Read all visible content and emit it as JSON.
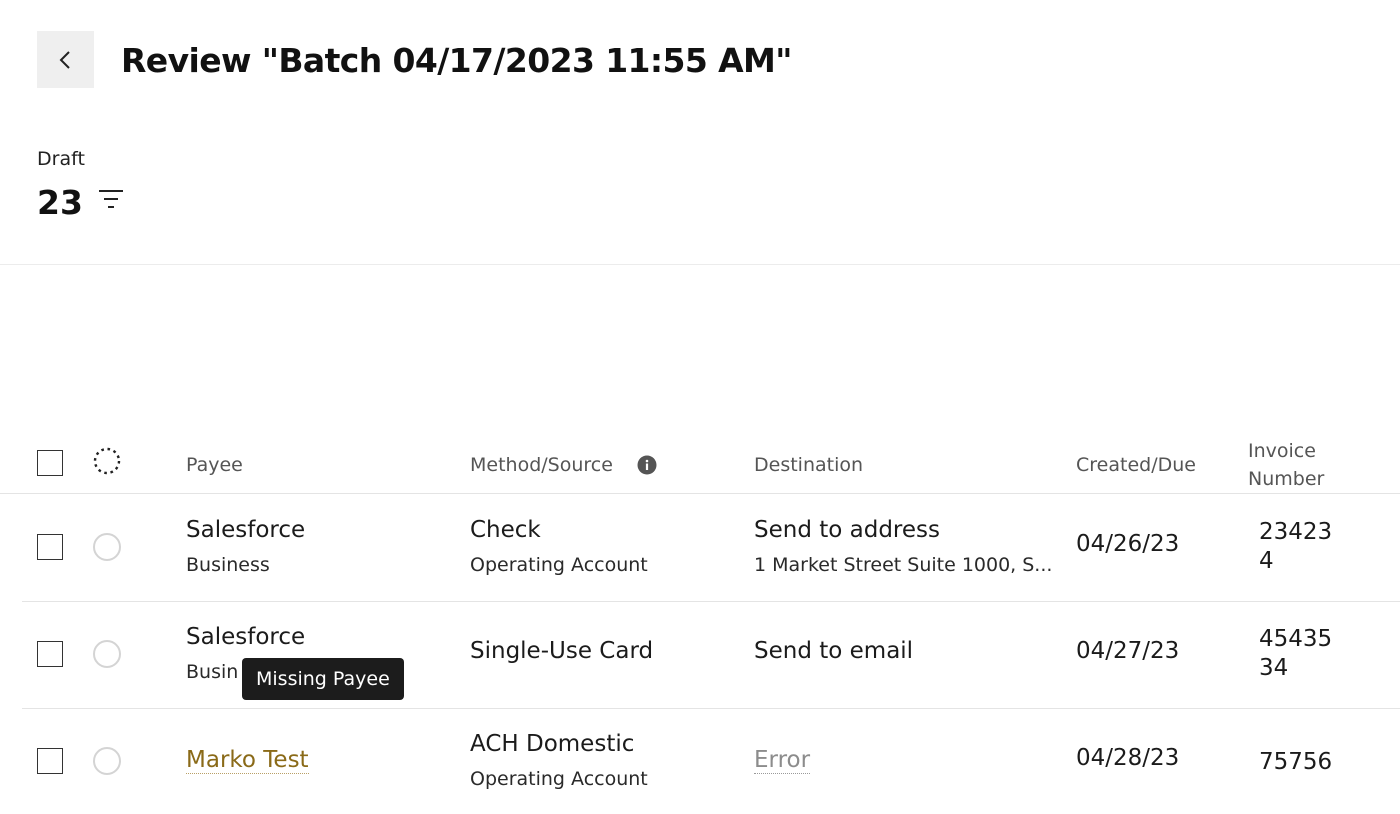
{
  "header": {
    "title": "Review \"Batch 04/17/2023 11:55 AM\"",
    "back_icon": "chevron-left-icon"
  },
  "summary": {
    "status_label": "Draft",
    "count": "23",
    "filter_icon": "filter-icon"
  },
  "table": {
    "columns": {
      "payee": "Payee",
      "method_source": "Method/Source",
      "destination": "Destination",
      "created_due": "Created/Due",
      "invoice_number": "Invoice Number"
    },
    "status_header_icon": "dashed-circle-icon",
    "info_icon": "info-icon",
    "rows": [
      {
        "payee": "Salesforce",
        "payee_type": "Business",
        "method": "Check",
        "source": "Operating Account",
        "destination": "Send to address",
        "destination_detail": "1 Market Street Suite 1000, S...",
        "created_due": "04/26/23",
        "invoice_number": "234234"
      },
      {
        "payee": "Salesforce",
        "payee_type": "Busin",
        "method": "Single-Use Card",
        "source": "",
        "destination": "Send to email",
        "destination_detail": "",
        "created_due": "04/27/23",
        "invoice_number": "4543534"
      },
      {
        "payee": "Marko Test",
        "payee_type": "",
        "method": "ACH Domestic",
        "source": "Operating Account",
        "destination": "Error",
        "destination_detail": "",
        "created_due": "04/28/23",
        "invoice_number": "75756"
      }
    ]
  },
  "tooltip": {
    "text": "Missing Payee"
  },
  "colors": {
    "link": "#8a6a18",
    "error": "#8c8c8c",
    "tooltip_bg": "#1c1c1c"
  }
}
